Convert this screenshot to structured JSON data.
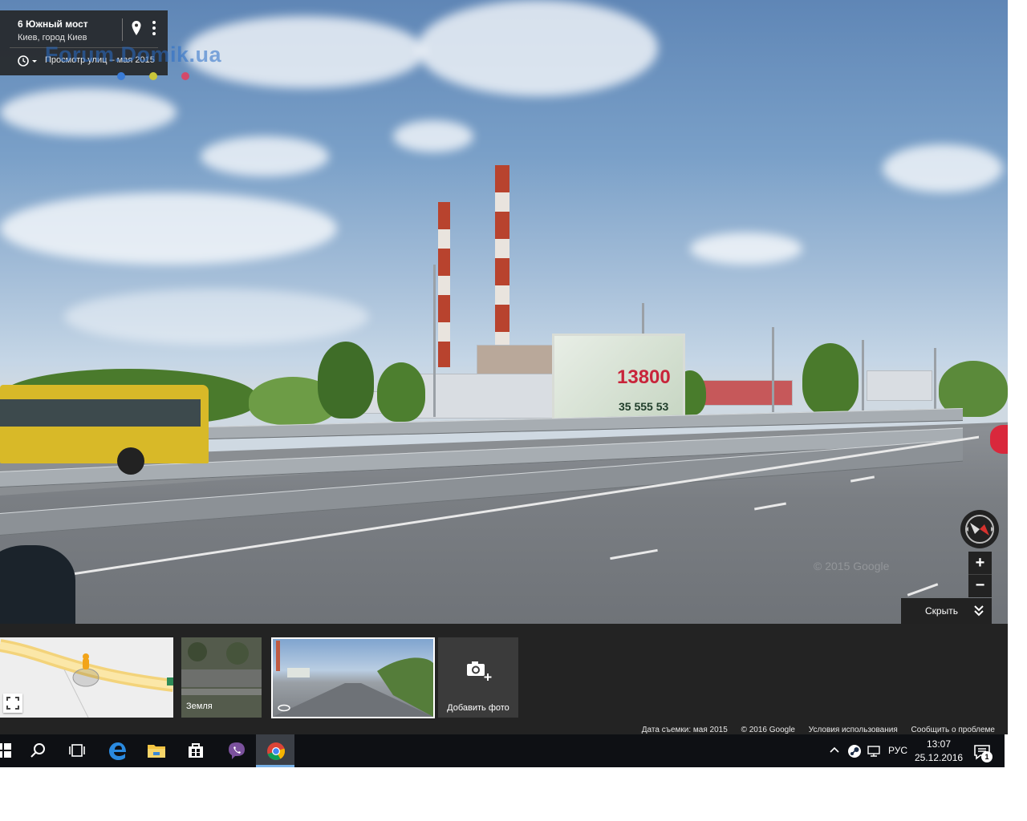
{
  "location_card": {
    "title": "6 Южный мост",
    "subtitle": "Киев, город Киев",
    "history_label": "Просмотр улиц – мая 2015"
  },
  "overlay_watermark": "Forum.Domik.ua",
  "billboard": {
    "number": "13800",
    "phone": "35 555 53"
  },
  "pano_watermark": "© 2015 Google",
  "controls": {
    "zoom_in": "+",
    "zoom_out": "−",
    "hide_label": "Скрыть"
  },
  "filmstrip": {
    "earth_label": "Земля",
    "add_photo_label": "Добавить фото"
  },
  "footer": {
    "capture_date": "Дата съемки: мая 2015",
    "copyright": "© 2016 Google",
    "terms": "Условия использования",
    "report": "Сообщить о проблеме"
  },
  "taskbar": {
    "language": "РУС",
    "time": "13:07",
    "date": "25.12.2016",
    "notification_count": "1"
  },
  "colors": {
    "panel_bg": "#232323",
    "taskbar_bg": "#0e1014",
    "accent_red": "#c8243a",
    "chrome_highlight": "#77b0e6"
  },
  "icons": [
    "pin-icon",
    "more-icon",
    "history-icon",
    "compass-icon",
    "chevron-double-down-icon",
    "fullscreen-icon",
    "camera-plus-icon",
    "windows-start-icon",
    "search-icon",
    "task-view-icon",
    "edge-icon",
    "file-explorer-icon",
    "store-icon",
    "viber-icon",
    "chrome-icon",
    "tray-chevron-icon",
    "steam-icon",
    "network-icon",
    "notification-icon"
  ]
}
